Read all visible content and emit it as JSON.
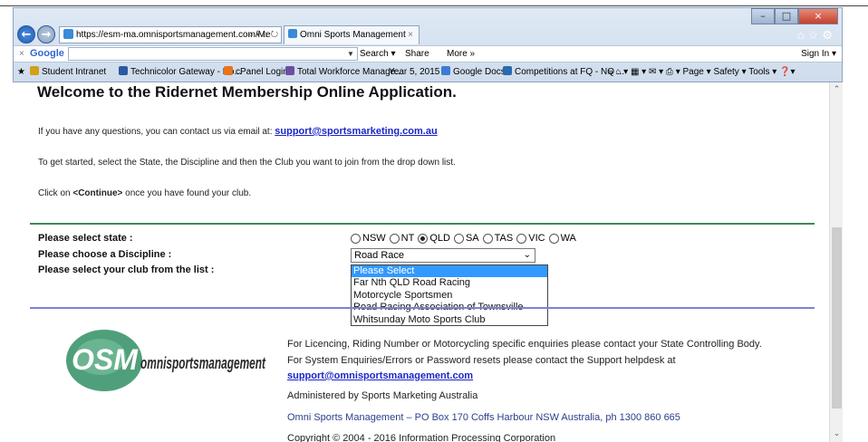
{
  "browser": {
    "address_url": "https://esm-ma.omnisportsmanagement.com/Me",
    "address_controls": "⌕ ▾ ⌂ ↻",
    "tab_title": "Omni Sports Management",
    "tab_close": "×",
    "window_min": "–",
    "window_max": "□",
    "window_close": "×",
    "ie_icons": "⌂☆⚙",
    "google_toolbar": {
      "close": "×",
      "logo": "Google",
      "search": "Search ▾",
      "share": "Share",
      "more": "More »",
      "sign_in": "Sign In ▾"
    },
    "favorites": [
      {
        "label": "Student Intranet",
        "color": "#d4a017"
      },
      {
        "label": "Technicolor Gateway - Ho...",
        "color": "#2c5aa0"
      },
      {
        "label": "cPanel Login",
        "color": "#e8731a"
      },
      {
        "label": "Total Workforce Manage...",
        "color": "#6b4fa0"
      },
      {
        "label": "Year 5, 2015",
        "color": "#ffffff"
      },
      {
        "label": "Google Docs",
        "color": "#3a7bd5"
      },
      {
        "label": "Competitions at FQ - NQ ...",
        "color": "#2a6ab0"
      }
    ],
    "command_bar": "»   ⌂ ▾  ▦ ▾  ✉ ▾  ⎙ ▾  Page ▾  Safety ▾  Tools ▾  ❓▾"
  },
  "page": {
    "heading": "Welcome to the Ridernet Membership Online Application.",
    "contact_text": "If you have any questions, you can contact us via email at:",
    "contact_email": "support@sportsmarketing.com.au",
    "instructions": "To get started, select the State, the Discipline and then the Club you want to join from the drop down list.",
    "click_prefix": "Click on",
    "click_button": "<Continue>",
    "click_suffix": "once you have found your club."
  },
  "form": {
    "state_label": "Please select state :",
    "discipline_label": "Please choose a Discipline :",
    "club_label": "Please select your club from the list :",
    "states": [
      "NSW",
      "NT",
      "QLD",
      "SA",
      "TAS",
      "VIC",
      "WA"
    ],
    "selected_state": "QLD",
    "discipline_value": "Road Race",
    "club_options": [
      "Please Select",
      "Far Nth QLD Road Racing",
      "Motorcycle Sportsmen",
      "Road Racing Association of Townsville",
      "Whitsunday Moto Sports Club"
    ],
    "selected_club": "Please Select"
  },
  "footer": {
    "logo_big": "OSM",
    "logo_small": "omnisportsmanagement",
    "licencing": "For Licencing, Riding Number or Motorcycling specific enquiries please contact your State Controlling Body.",
    "system": "For System Enquiries/Errors or Password resets please contact the Support helpdesk at",
    "support_email": "support@omnisportsmanagement.com",
    "administered": "Administered by Sports Marketing Australia",
    "address": "Omni Sports Management – PO Box 170 Coffs Harbour NSW Australia, ph 1300 860 665",
    "copyright": "Copyright © 2004 - 2016 Information Processing Corporation"
  }
}
